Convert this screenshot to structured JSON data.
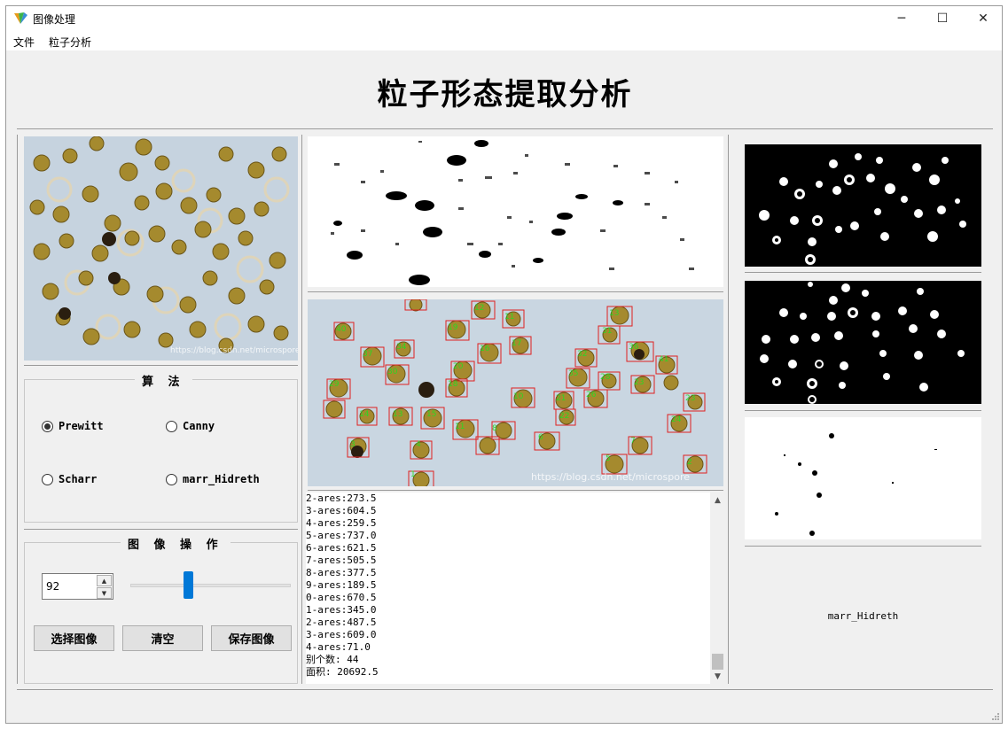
{
  "window": {
    "title": "图像处理",
    "controls": {
      "minimize": "─",
      "maximize": "☐",
      "close": "✕"
    }
  },
  "menu": {
    "items": [
      "文件",
      "粒子分析"
    ]
  },
  "app_title": "粒子形态提取分析",
  "images": {
    "original": {
      "watermark": "https://blog.csdn.net/microspore"
    },
    "detected": {
      "watermark": "https://blog.csdn.net/microspore"
    }
  },
  "algorithm_group": {
    "title": "算 法",
    "options": [
      {
        "label": "Prewitt",
        "selected": true
      },
      {
        "label": "Canny",
        "selected": false
      },
      {
        "label": "Scharr",
        "selected": false
      },
      {
        "label": "marr_Hidreth",
        "selected": false
      }
    ]
  },
  "image_ops_group": {
    "title": "图 像 操 作",
    "spin_value": "92",
    "slider_value": 92,
    "buttons": {
      "select": "选择图像",
      "clear": "清空",
      "save": "保存图像"
    }
  },
  "output_lines": [
    "2-ares:273.5",
    "3-ares:604.5",
    "4-ares:259.5",
    "5-ares:737.0",
    "6-ares:621.5",
    "7-ares:505.5",
    "8-ares:377.5",
    "9-ares:189.5",
    "0-ares:670.5",
    "1-ares:345.0",
    "2-ares:487.5",
    "3-ares:609.0",
    "4-ares:71.0",
    "别个数: 44",
    "面积: 20692.5"
  ],
  "right_panel_label": "marr_Hidreth",
  "colors": {
    "accent": "#0078d7",
    "box_red": "#e02020",
    "label_green": "#22dd22"
  }
}
